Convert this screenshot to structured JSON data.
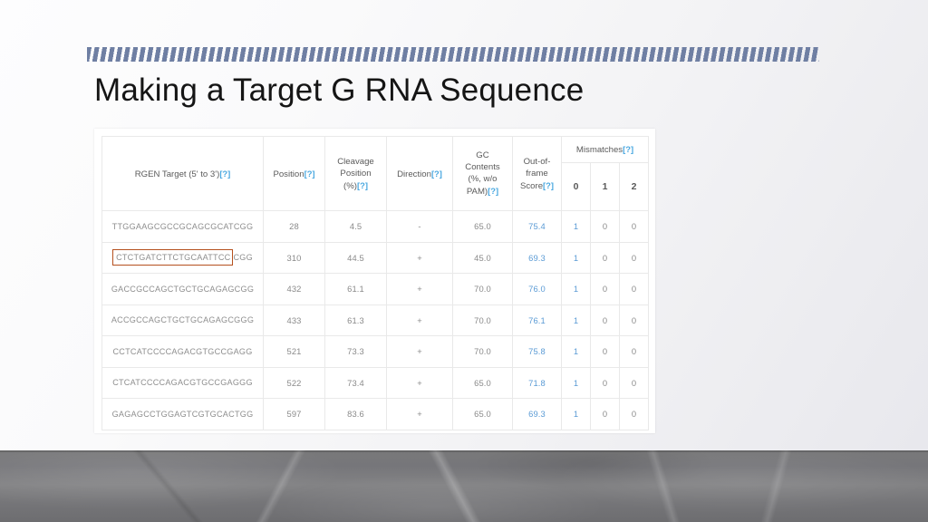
{
  "slide": {
    "title": "Making a Target G RNA Sequence"
  },
  "colors": {
    "stripe": "#6f7fa3",
    "title_text": "#151515",
    "help_link": "#4aa8e0",
    "score_blue": "#5b9bd5",
    "highlight_box": "#b5501e",
    "table_border": "#e9e9e9",
    "cell_text": "#8a8a8a",
    "header_text": "#5a5a5a",
    "floor_band": "#79797a"
  },
  "table": {
    "help_marker": "[?]",
    "headers": {
      "target": "RGEN Target (5' to 3')",
      "position": "Position",
      "cleavage_position": "Cleavage Position (%)",
      "direction": "Direction",
      "gc_contents": "GC Contents (%, w/o PAM)",
      "out_of_frame_score": "Out-of-frame Score",
      "mismatches": "Mismatches"
    },
    "header_lines": {
      "cleavage_l1": "Cleavage",
      "cleavage_l2": "Position",
      "cleavage_l3": "(%)",
      "gc_l1": "GC",
      "gc_l2": "Contents",
      "gc_l3": "(%, w/o",
      "gc_l4": "PAM)",
      "oof_l1": "Out-of-",
      "oof_l2": "frame",
      "oof_l3": "Score"
    },
    "mismatch_columns": [
      "0",
      "1",
      "2"
    ],
    "rows": [
      {
        "sequence": "TTGGAAGCGCCGCAGCGCATCGG",
        "protospacer": "TTGGAAGCGCCGCAGCGCAT",
        "pam": "CGG",
        "highlighted": false,
        "position": "28",
        "cleavage_position": "4.5",
        "direction": "-",
        "gc_contents": "65.0",
        "out_of_frame_score": "75.4",
        "mismatch_0": "1",
        "mismatch_1": "0",
        "mismatch_2": "0"
      },
      {
        "sequence": "CTCTGATCTTCTGCAATTCCCGG",
        "protospacer": "CTCTGATCTTCTGCAATTCC",
        "pam": "CGG",
        "highlighted": true,
        "position": "310",
        "cleavage_position": "44.5",
        "direction": "+",
        "gc_contents": "45.0",
        "out_of_frame_score": "69.3",
        "mismatch_0": "1",
        "mismatch_1": "0",
        "mismatch_2": "0"
      },
      {
        "sequence": "GACCGCCAGCTGCTGCAGAGCGG",
        "protospacer": "GACCGCCAGCTGCTGCAGAG",
        "pam": "CGG",
        "highlighted": false,
        "position": "432",
        "cleavage_position": "61.1",
        "direction": "+",
        "gc_contents": "70.0",
        "out_of_frame_score": "76.0",
        "mismatch_0": "1",
        "mismatch_1": "0",
        "mismatch_2": "0"
      },
      {
        "sequence": "ACCGCCAGCTGCTGCAGAGCGGG",
        "protospacer": "ACCGCCAGCTGCTGCAGAGC",
        "pam": "GGG",
        "highlighted": false,
        "position": "433",
        "cleavage_position": "61.3",
        "direction": "+",
        "gc_contents": "70.0",
        "out_of_frame_score": "76.1",
        "mismatch_0": "1",
        "mismatch_1": "0",
        "mismatch_2": "0"
      },
      {
        "sequence": "CCTCATCCCCAGACGTGCCGAGG",
        "protospacer": "CCTCATCCCCAGACGTGCCG",
        "pam": "AGG",
        "highlighted": false,
        "position": "521",
        "cleavage_position": "73.3",
        "direction": "+",
        "gc_contents": "70.0",
        "out_of_frame_score": "75.8",
        "mismatch_0": "1",
        "mismatch_1": "0",
        "mismatch_2": "0"
      },
      {
        "sequence": "CTCATCCCCAGACGTGCCGAGGG",
        "protospacer": "CTCATCCCCAGACGTGCCGA",
        "pam": "GGG",
        "highlighted": false,
        "position": "522",
        "cleavage_position": "73.4",
        "direction": "+",
        "gc_contents": "65.0",
        "out_of_frame_score": "71.8",
        "mismatch_0": "1",
        "mismatch_1": "0",
        "mismatch_2": "0"
      },
      {
        "sequence": "GAGAGCCTGGAGTCGTGCACTGG",
        "protospacer": "GAGAGCCTGGAGTCGTGCAC",
        "pam": "TGG",
        "highlighted": false,
        "position": "597",
        "cleavage_position": "83.6",
        "direction": "+",
        "gc_contents": "65.0",
        "out_of_frame_score": "69.3",
        "mismatch_0": "1",
        "mismatch_1": "0",
        "mismatch_2": "0"
      }
    ]
  }
}
